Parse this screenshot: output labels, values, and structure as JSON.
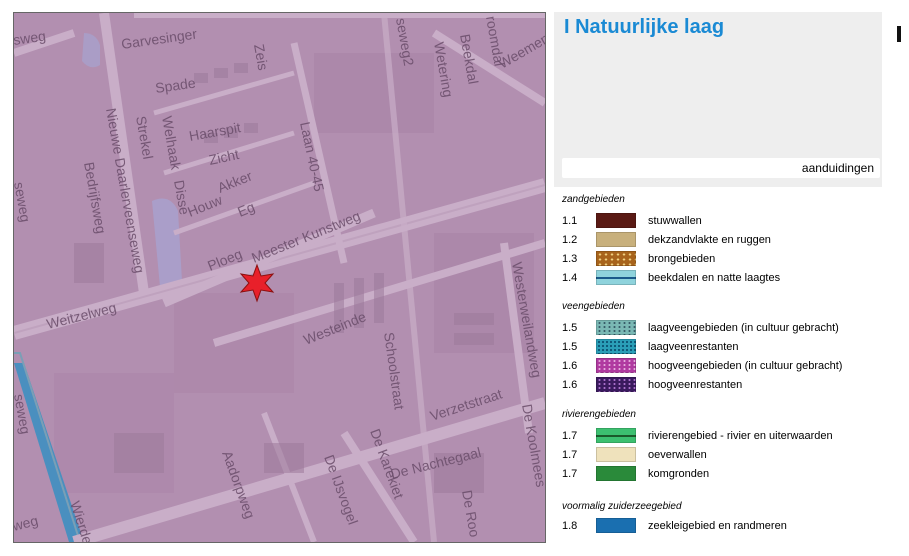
{
  "map": {
    "streets": [
      "Garvesinger",
      "Spade",
      "Zeis",
      "Welhaak",
      "Haarspit",
      "Strekel",
      "Zicht",
      "Akker",
      "Houw",
      "Eg",
      "Disse",
      "Nieuwe Daarlerveenseweg",
      "Bedrijfsweg",
      "Ploeg",
      "Meester Kunstweg",
      "Weitzelweg",
      "Laan 40-45",
      "Westeinde",
      "Schoolstraat",
      "Verzetstraat",
      "De Karekiet",
      "De Nachtegaal",
      "Aadorpweg",
      "De IJsvogel",
      "De Koolmees",
      "Westerweilandweg",
      "Wetering",
      "Beekdal",
      "Weemen",
      "De Roo",
      "Wierde",
      "sweg",
      "seweg",
      "weg",
      "roomdal",
      "seweg2"
    ],
    "marker": "red-star",
    "colors": {
      "overlay": "#b28fb0",
      "water": "#4a8fbf",
      "road": "#c9aec8",
      "marker": "#e8202a"
    }
  },
  "legend": {
    "title": "I Natuurlijke laag",
    "tab_label": "aanduidingen",
    "sections": [
      {
        "title": "zandgebieden",
        "items": [
          {
            "code": "1.1",
            "label": "stuwwallen",
            "color": "#5a1a14"
          },
          {
            "code": "1.2",
            "label": "dekzandvlakte en ruggen",
            "color": "#c8b07c"
          },
          {
            "code": "1.3",
            "label": "brongebieden",
            "color": "#a8641c"
          },
          {
            "code": "1.4",
            "label": "beekdalen en natte laagtes",
            "color": "#8fd3dc"
          }
        ]
      },
      {
        "title": "veengebieden",
        "items": [
          {
            "code": "1.5",
            "label": "laagveengebieden (in cultuur gebracht)",
            "color": "#7ab8b4"
          },
          {
            "code": "1.5",
            "label": "laagveenrestanten",
            "color": "#2a9fb8"
          },
          {
            "code": "1.6",
            "label": "hoogveengebieden (in cultuur gebracht)",
            "color": "#b03aa0"
          },
          {
            "code": "1.6",
            "label": "hoogveenrestanten",
            "color": "#3a1a5e"
          }
        ]
      },
      {
        "title": "rivierengebieden",
        "items": [
          {
            "code": "1.7",
            "label": "rivierengebied - rivier en uiterwaarden",
            "color": "#3cc070"
          },
          {
            "code": "1.7",
            "label": "oeverwallen",
            "color": "#efe2bc"
          },
          {
            "code": "1.7",
            "label": "komgronden",
            "color": "#2a8a3a"
          }
        ]
      },
      {
        "title": "voormalig zuiderzeegebied",
        "items": [
          {
            "code": "1.8",
            "label": "zeekleigebied en randmeren",
            "color": "#1a6fb0"
          }
        ]
      }
    ]
  }
}
